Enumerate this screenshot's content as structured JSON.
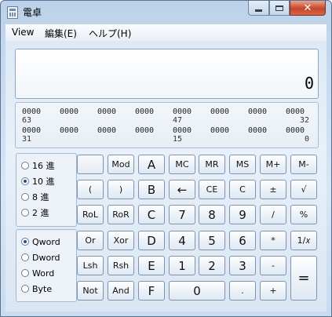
{
  "window": {
    "title": "電卓"
  },
  "menu": {
    "view": "View",
    "edit": "編集(E)",
    "help": "ヘルプ(H)"
  },
  "display": {
    "value": "0"
  },
  "bits": {
    "row1": [
      "0000",
      "0000",
      "0000",
      "0000",
      "0000",
      "0000",
      "0000",
      "0000"
    ],
    "row1_positions": [
      "63",
      "47",
      "32"
    ],
    "row2": [
      "0000",
      "0000",
      "0000",
      "0000",
      "0000",
      "0000",
      "0000",
      "0000"
    ],
    "row2_positions": [
      "31",
      "15",
      "0"
    ]
  },
  "radix": {
    "options": [
      "16 進",
      "10 進",
      "8 進",
      "2 進"
    ],
    "selected": "10 進"
  },
  "wordsize": {
    "options": [
      "Qword",
      "Dword",
      "Word",
      "Byte"
    ],
    "selected": "Qword"
  },
  "keys": {
    "mod": "Mod",
    "a": "A",
    "mc": "MC",
    "mr": "MR",
    "ms": "MS",
    "mplus": "M+",
    "mminus": "M-",
    "lparen": "(",
    "rparen": ")",
    "b": "B",
    "back": "←",
    "ce": "CE",
    "c": "C",
    "plusminus": "±",
    "sqrt": "√",
    "rol": "RoL",
    "ror": "RoR",
    "cc": "C",
    "n7": "7",
    "n8": "8",
    "n9": "9",
    "div": "/",
    "pct": "%",
    "or": "Or",
    "xor": "Xor",
    "d": "D",
    "n4": "4",
    "n5": "5",
    "n6": "6",
    "mul": "*",
    "recip": "1/𝑥",
    "lsh": "Lsh",
    "rsh": "Rsh",
    "e": "E",
    "n1": "1",
    "n2": "2",
    "n3": "3",
    "sub": "-",
    "eq": "=",
    "not": "Not",
    "and": "And",
    "f": "F",
    "n0": "0",
    "dot": ".",
    "add": "+"
  }
}
